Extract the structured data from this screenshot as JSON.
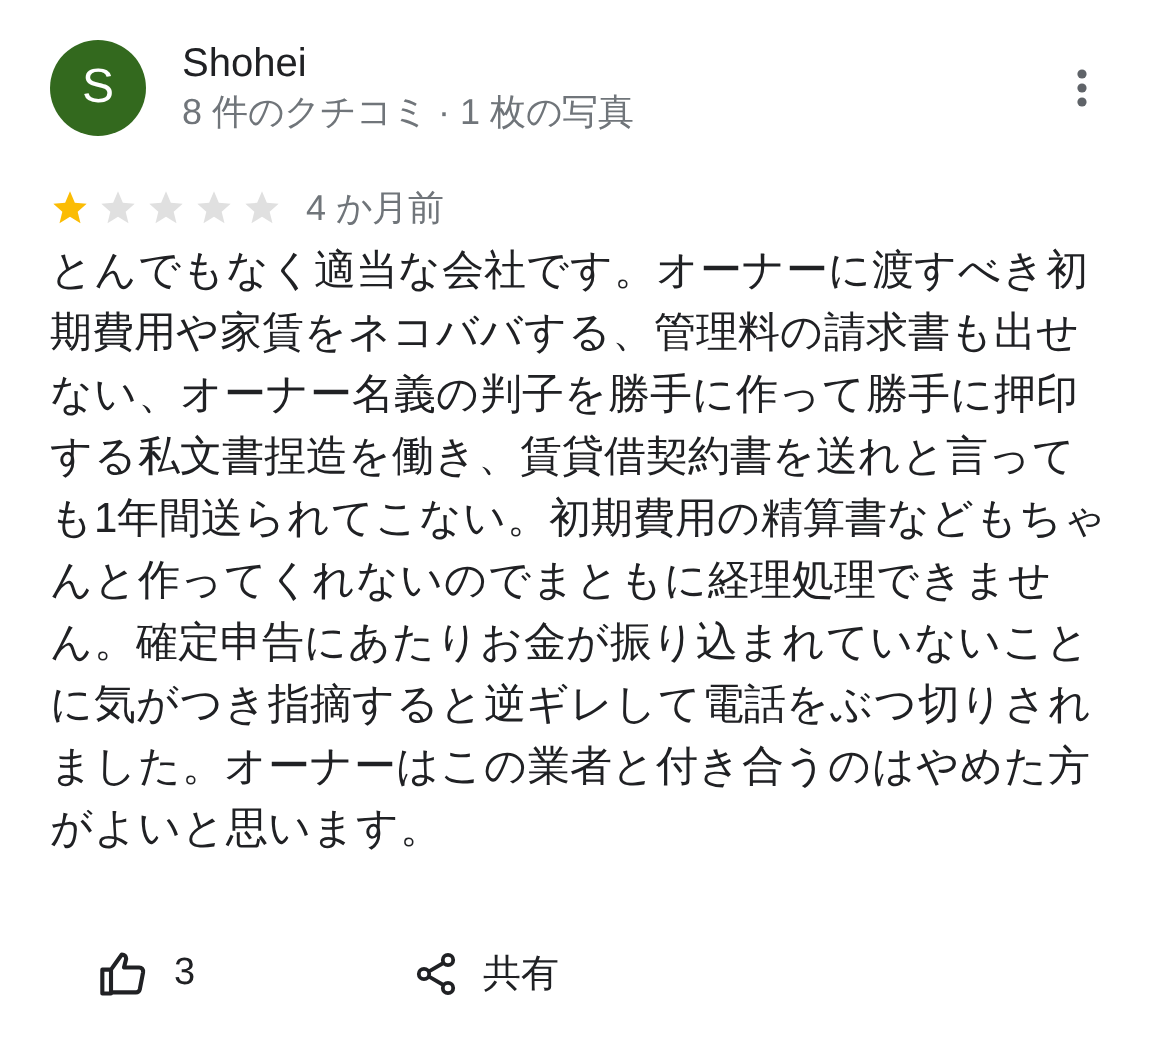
{
  "review": {
    "avatar_letter": "S",
    "name": "Shohei",
    "meta": "8 件のクチコミ · 1 枚の写真",
    "stars": 1,
    "time": "4 か月前",
    "text": "とんでもなく適当な会社です。オーナーに渡すべき初期費用や家賃をネコババする、管理料の請求書も出せない、オーナー名義の判子を勝手に作って勝手に押印する私文書捏造を働き、賃貸借契約書を送れと言っても1年間送られてこない。初期費用の精算書などもちゃんと作ってくれないのでまともに経理処理できません。確定申告にあたりお金が振り込まれていないことに気がつき指摘すると逆ギレして電話をぶつ切りされました。オーナーはこの業者と付き合うのはやめた方がよいと思います。",
    "like_count": "3",
    "share_label": "共有"
  }
}
